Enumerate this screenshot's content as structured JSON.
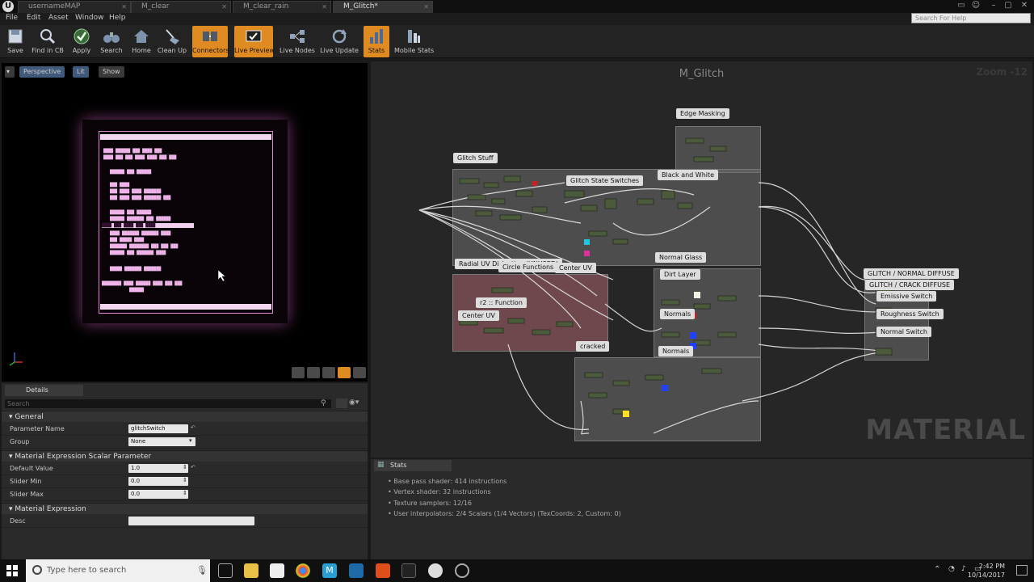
{
  "tabs": [
    {
      "label": "usernameMAP"
    },
    {
      "label": "M_clear"
    },
    {
      "label": "M_clear_rain"
    },
    {
      "label": "M_Glitch*"
    }
  ],
  "menu": [
    "File",
    "Edit",
    "Asset",
    "Window",
    "Help"
  ],
  "help_search": {
    "placeholder": "Search For Help"
  },
  "toolbar": [
    {
      "label": "Save",
      "icon": "save-icon",
      "active": false
    },
    {
      "label": "Find in CB",
      "icon": "magnifier-icon",
      "active": false
    },
    {
      "label": "Apply",
      "icon": "checkmark-icon",
      "active": false
    },
    {
      "label": "Search",
      "icon": "binoculars-icon",
      "active": false
    },
    {
      "label": "Home",
      "icon": "home-icon",
      "active": false
    },
    {
      "label": "Clean Up",
      "icon": "broom-icon",
      "active": false
    },
    {
      "label": "Connectors",
      "icon": "connectors-icon",
      "active": true
    },
    {
      "label": "Live Preview",
      "icon": "live-preview-icon",
      "active": true
    },
    {
      "label": "Live Nodes",
      "icon": "live-nodes-icon",
      "active": false
    },
    {
      "label": "Live Update",
      "icon": "refresh-icon",
      "active": false
    },
    {
      "label": "Stats",
      "icon": "stats-icon",
      "active": true
    },
    {
      "label": "Mobile Stats",
      "icon": "mobile-stats-icon",
      "active": false
    }
  ],
  "viewport": {
    "perspective": "Perspective",
    "lit": "Lit",
    "show": "Show"
  },
  "details": {
    "tab": "Details",
    "search_placeholder": "Search",
    "general": "General",
    "param_name_label": "Parameter Name",
    "param_name_value": "glitchSwitch",
    "group_label": "Group",
    "group_value": "None",
    "scalar_section": "Material Expression Scalar Parameter",
    "default_value_label": "Default Value",
    "default_value": "1.0",
    "slider_min_label": "Slider Min",
    "slider_min": "0.0",
    "slider_max_label": "Slider Max",
    "slider_max": "0.0",
    "expression_section": "Material Expression",
    "desc_label": "Desc",
    "desc_value": ""
  },
  "graph": {
    "title": "M_Glitch",
    "zoom": "Zoom -12",
    "watermark": "MATERIAL",
    "comments": [
      "Edge Masking",
      "Glitch Stuff",
      "Glitch State Switches",
      "Black and White",
      "Normal Glass",
      "Dirt Layer",
      "Radial UV Distortion (UNUSED)",
      "Circle Functions",
      "Center UV",
      "r2 :: Function",
      "Center UV",
      "Normals",
      "Normals",
      "cracked",
      "GLITCH / NORMAL DIFFUSE",
      "GLITCH / CRACK DIFFUSE",
      "Emissive Switch",
      "Roughness Switch",
      "Normal Switch"
    ]
  },
  "stats": {
    "tab": "Stats",
    "lines": [
      "Base pass shader: 414 instructions",
      "Vertex shader: 32 instructions",
      "Texture samplers: 12/16",
      "User interpolators: 2/4 Scalars (1/4 Vectors) (TexCoords: 2, Custom: 0)"
    ]
  },
  "taskbar": {
    "search_placeholder": "Type here to search",
    "time": "2:42 PM",
    "date": "10/14/2017"
  },
  "colors": {
    "accent": "#e08a22",
    "comment_box": "#6e6e6e",
    "unused_box": "#aa646e",
    "glow": "#d58ad0"
  }
}
